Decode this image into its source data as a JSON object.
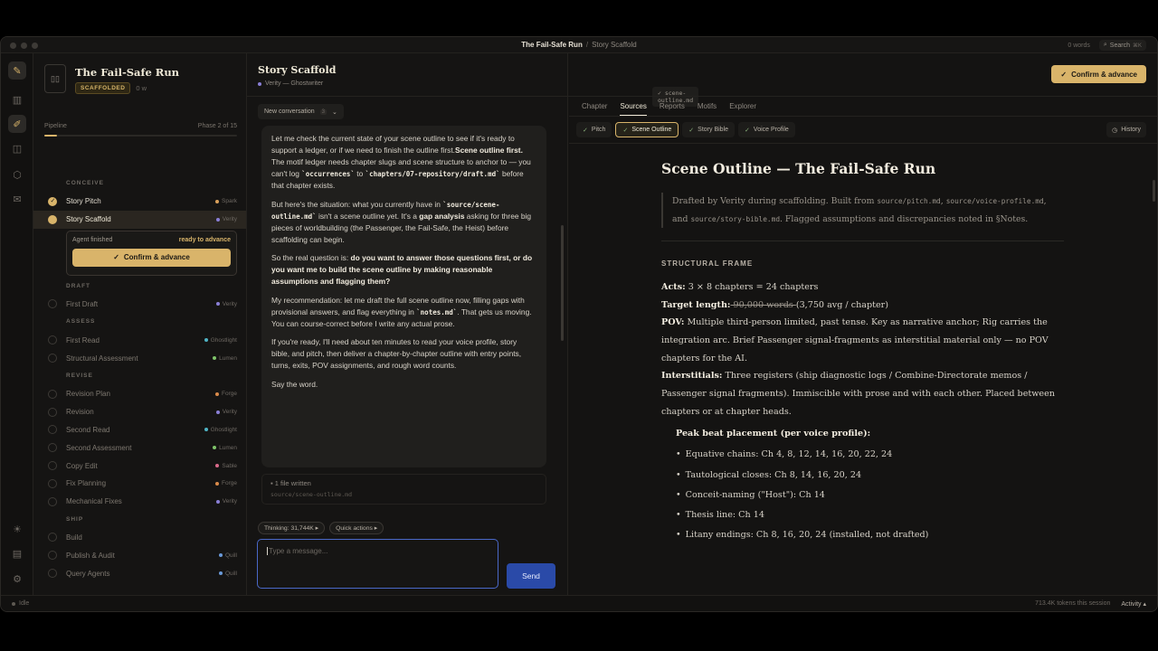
{
  "titlebar": {
    "project": "The Fail-Safe Run",
    "separator": "/",
    "page": "Story Scaffold",
    "word_count": "0 words",
    "search_label": "Search",
    "search_kbd": "⌘K"
  },
  "sidebar": {
    "title": "The Fail-Safe Run",
    "badge": "SCAFFOLDED",
    "words": "0 w",
    "pipeline_label": "Pipeline",
    "phase_label": "Phase 2 of 15",
    "pipeline_progress": 0.067,
    "agent_card": {
      "status": "Agent finished",
      "ready": "ready to advance",
      "button": "Confirm & advance"
    },
    "groups": [
      {
        "label": "CONCEIVE",
        "items": [
          {
            "label": "Story Pitch",
            "agent": "Spark",
            "agent_color": "#d9a05b",
            "state": "done"
          },
          {
            "label": "Story Scaffold",
            "agent": "Verity",
            "agent_color": "#8a7fd6",
            "state": "current"
          }
        ]
      },
      {
        "label": "DRAFT",
        "items": [
          {
            "label": "First Draft",
            "agent": "Verity",
            "agent_color": "#8a7fd6",
            "state": "todo"
          }
        ]
      },
      {
        "label": "ASSESS",
        "items": [
          {
            "label": "First Read",
            "agent": "Ghostlight",
            "agent_color": "#4fb3c4",
            "state": "todo"
          },
          {
            "label": "Structural Assessment",
            "agent": "Lumen",
            "agent_color": "#7fc46a",
            "state": "todo"
          }
        ]
      },
      {
        "label": "REVISE",
        "items": [
          {
            "label": "Revision Plan",
            "agent": "Forge",
            "agent_color": "#d98a4a",
            "state": "todo"
          },
          {
            "label": "Revision",
            "agent": "Verity",
            "agent_color": "#8a7fd6",
            "state": "todo"
          },
          {
            "label": "Second Read",
            "agent": "Ghostlight",
            "agent_color": "#4fb3c4",
            "state": "todo"
          },
          {
            "label": "Second Assessment",
            "agent": "Lumen",
            "agent_color": "#7fc46a",
            "state": "todo"
          },
          {
            "label": "Copy Edit",
            "agent": "Sable",
            "agent_color": "#d96a8a",
            "state": "todo"
          },
          {
            "label": "Fix Planning",
            "agent": "Forge",
            "agent_color": "#d98a4a",
            "state": "todo"
          },
          {
            "label": "Mechanical Fixes",
            "agent": "Verity",
            "agent_color": "#8a7fd6",
            "state": "todo"
          }
        ]
      },
      {
        "label": "SHIP",
        "items": [
          {
            "label": "Build",
            "agent": "",
            "agent_color": "",
            "state": "todo"
          },
          {
            "label": "Publish & Audit",
            "agent": "Quill",
            "agent_color": "#6a9ad9",
            "state": "todo"
          },
          {
            "label": "Query Agents",
            "agent": "Quill",
            "agent_color": "#6a9ad9",
            "state": "todo"
          }
        ]
      }
    ]
  },
  "chat": {
    "title": "Story Scaffold",
    "subtitle": "Verity — Ghostwriter",
    "file_chip": "✓ scene-outline.md",
    "new_conversation": "New conversation",
    "conv_count": "3",
    "files_written": "1 file written",
    "file_path": "source/scene-outline.md",
    "thinking": "Thinking: 31,744K ▸",
    "quick_actions": "Quick actions ▸",
    "placeholder": "Type a message...",
    "send": "Send"
  },
  "header": {
    "confirm_button": "Confirm & advance"
  },
  "viewer": {
    "tabs": [
      "Chapter",
      "Sources",
      "Reports",
      "Motifs",
      "Explorer"
    ],
    "active_tab": "Sources",
    "subtabs": [
      "Pitch",
      "Scene Outline",
      "Story Bible",
      "Voice Profile"
    ],
    "active_subtab": "Scene Outline",
    "history": "History",
    "doc": {
      "title": "Scene Outline — The Fail-Safe Run",
      "quote_1": "Drafted by Verity during scaffolding. Built from ",
      "quote_path_1": "source/pitch.md",
      "quote_2": ", ",
      "quote_path_2": "source/voice-profile.md",
      "quote_3": ", and ",
      "quote_path_3": "source/story-bible.md",
      "quote_4": ". Flagged assumptions and discrepancies noted in §Notes.",
      "section": "STRUCTURAL FRAME",
      "acts_label": "Acts:",
      "acts_value": " 3 × 8 chapters = 24 chapters",
      "target_label": "Target length:",
      "target_strike": " 90,000 words ",
      "target_value": "(3,750 avg / chapter)",
      "pov_label": "POV:",
      "pov_value": " Multiple third-person limited, past tense. Key as narrative anchor; Rig carries the integration arc. Brief Passenger signal-fragments as interstitial material only — no POV chapters for the AI.",
      "inter_label": "Interstitials:",
      "inter_value": " Three registers (ship diagnostic logs / Combine-Directorate memos / Passenger signal fragments). Immiscible with prose and with each other. Placed between chapters or at chapter heads.",
      "peak_heading": "Peak beat placement (per voice profile):",
      "bullets": [
        "Equative chains: Ch 4, 8, 12, 14, 16, 20, 22, 24",
        "Tautological closes: Ch 8, 14, 16, 20, 24",
        "Conceit-naming (\"Host\"): Ch 14",
        "Thesis line: Ch 14",
        "Litany endings: Ch 8, 16, 20, 24 (installed, not drafted)"
      ]
    }
  },
  "messages": {
    "p1a": "Let me check the current state of your scene outline to see if it's ready to support a ledger, or if we need to finish the outline first.",
    "p1b": "Scene outline first.",
    "p1c": " The motif ledger needs chapter slugs and scene structure to anchor to — you can't log ",
    "p1code1": "`occurrences`",
    "p1d": " to ",
    "p1code2": "`chapters/07-repository/draft.md`",
    "p1e": " before that chapter exists.",
    "p2a": "But here's the situation: what you currently have in ",
    "p2code": "`source/scene-outline.md`",
    "p2b": " isn't a scene outline yet. It's a ",
    "p2bold": "gap analysis",
    "p2c": " asking for three big pieces of worldbuilding (the Passenger, the Fail-Safe, the Heist) before scaffolding can begin.",
    "p3a": "So the real question is: ",
    "p3bold": "do you want to answer those questions first, or do you want me to build the scene outline by making reasonable assumptions and flagging them?",
    "p4a": "My recommendation: let me draft the full scene outline now, filling gaps with provisional answers, and flag everything in ",
    "p4code": "`notes.md`",
    "p4b": ". That gets us moving. You can course-correct before I write any actual prose.",
    "p5": "If you're ready, I'll need about ten minutes to read your voice profile, story bible, and pitch, then deliver a chapter-by-chapter outline with entry points, turns, exits, POV assignments, and rough word counts.",
    "p6": "Say the word."
  },
  "status": {
    "state": "Idle",
    "tokens": "713.4K tokens this session",
    "activity": "Activity ▴"
  }
}
